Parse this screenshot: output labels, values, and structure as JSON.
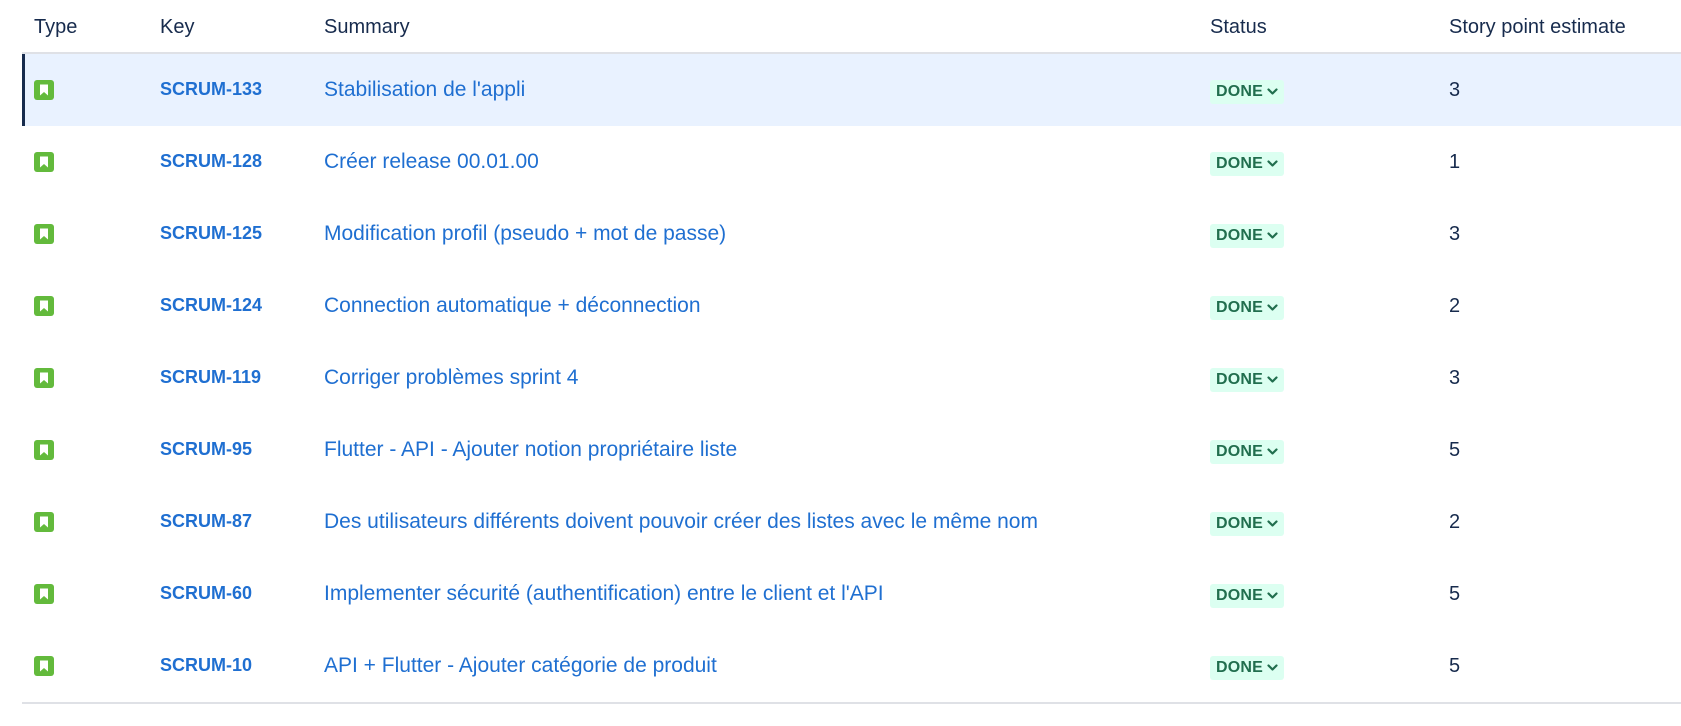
{
  "columns": {
    "type": "Type",
    "key": "Key",
    "summary": "Summary",
    "status": "Status",
    "story_points": "Story point estimate"
  },
  "colors": {
    "story_icon": "#63ba3c",
    "link": "#1f6fd1",
    "done_bg": "#dcfff1",
    "done_text": "#216e4e",
    "selected_row_bg": "#e9f2ff"
  },
  "rows": [
    {
      "type_icon": "story-icon",
      "key": "SCRUM-133",
      "summary": "Stabilisation de l'appli",
      "status": "DONE",
      "story_points": "3",
      "selected": true
    },
    {
      "type_icon": "story-icon",
      "key": "SCRUM-128",
      "summary": "Créer release 00.01.00",
      "status": "DONE",
      "story_points": "1"
    },
    {
      "type_icon": "story-icon",
      "key": "SCRUM-125",
      "summary": "Modification profil (pseudo + mot de passe)",
      "status": "DONE",
      "story_points": "3"
    },
    {
      "type_icon": "story-icon",
      "key": "SCRUM-124",
      "summary": "Connection automatique + déconnection",
      "status": "DONE",
      "story_points": "2"
    },
    {
      "type_icon": "story-icon",
      "key": "SCRUM-119",
      "summary": "Corriger problèmes sprint 4",
      "status": "DONE",
      "story_points": "3"
    },
    {
      "type_icon": "story-icon",
      "key": "SCRUM-95",
      "summary": "Flutter - API - Ajouter notion propriétaire liste",
      "status": "DONE",
      "story_points": "5"
    },
    {
      "type_icon": "story-icon",
      "key": "SCRUM-87",
      "summary": "Des utilisateurs différents doivent pouvoir créer des listes avec le même nom",
      "status": "DONE",
      "story_points": "2"
    },
    {
      "type_icon": "story-icon",
      "key": "SCRUM-60",
      "summary": "Implementer sécurité (authentification) entre le client et l'API",
      "status": "DONE",
      "story_points": "5"
    },
    {
      "type_icon": "story-icon",
      "key": "SCRUM-10",
      "summary": "API + Flutter - Ajouter catégorie de produit",
      "status": "DONE",
      "story_points": "5"
    }
  ]
}
